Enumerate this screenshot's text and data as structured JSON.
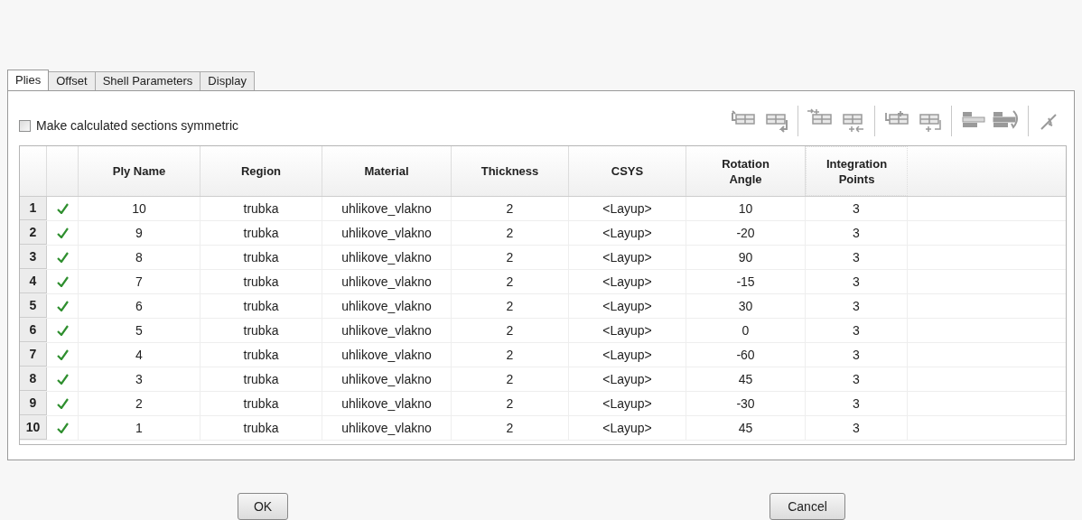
{
  "tabs": [
    {
      "label": "Plies",
      "selected": true
    },
    {
      "label": "Offset",
      "selected": false
    },
    {
      "label": "Shell Parameters",
      "selected": false
    },
    {
      "label": "Display",
      "selected": false
    }
  ],
  "symmetric": {
    "label": "Make calculated sections symmetric",
    "checked": false
  },
  "table": {
    "columns": [
      "Ply Name",
      "Region",
      "Material",
      "Thickness",
      "CSYS",
      "Rotation Angle",
      "Integration Points"
    ],
    "rows": [
      {
        "index": "1",
        "valid": true,
        "cells": [
          "10",
          "trubka",
          "uhlikove_vlakno",
          "2",
          "<Layup>",
          "10",
          "3"
        ]
      },
      {
        "index": "2",
        "valid": true,
        "cells": [
          "9",
          "trubka",
          "uhlikove_vlakno",
          "2",
          "<Layup>",
          "-20",
          "3"
        ]
      },
      {
        "index": "3",
        "valid": true,
        "cells": [
          "8",
          "trubka",
          "uhlikove_vlakno",
          "2",
          "<Layup>",
          "90",
          "3"
        ]
      },
      {
        "index": "4",
        "valid": true,
        "cells": [
          "7",
          "trubka",
          "uhlikove_vlakno",
          "2",
          "<Layup>",
          "-15",
          "3"
        ]
      },
      {
        "index": "5",
        "valid": true,
        "cells": [
          "6",
          "trubka",
          "uhlikove_vlakno",
          "2",
          "<Layup>",
          "30",
          "3"
        ]
      },
      {
        "index": "6",
        "valid": true,
        "cells": [
          "5",
          "trubka",
          "uhlikove_vlakno",
          "2",
          "<Layup>",
          "0",
          "3"
        ]
      },
      {
        "index": "7",
        "valid": true,
        "cells": [
          "4",
          "trubka",
          "uhlikove_vlakno",
          "2",
          "<Layup>",
          "-60",
          "3"
        ]
      },
      {
        "index": "8",
        "valid": true,
        "cells": [
          "3",
          "trubka",
          "uhlikove_vlakno",
          "2",
          "<Layup>",
          "45",
          "3"
        ]
      },
      {
        "index": "9",
        "valid": true,
        "cells": [
          "2",
          "trubka",
          "uhlikove_vlakno",
          "2",
          "<Layup>",
          "-30",
          "3"
        ]
      },
      {
        "index": "10",
        "valid": true,
        "cells": [
          "1",
          "trubka",
          "uhlikove_vlakno",
          "2",
          "<Layup>",
          "45",
          "3"
        ]
      }
    ]
  },
  "buttons": [
    "OK",
    "Cancel"
  ]
}
